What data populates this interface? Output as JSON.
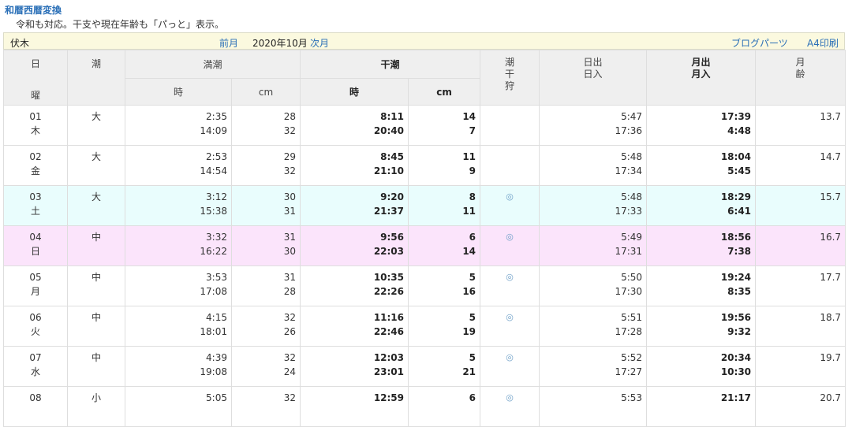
{
  "header": {
    "title_link": "和暦西暦変換",
    "subtitle": "令和も対応。干支や現在年齢も「パっと」表示。"
  },
  "nav": {
    "location": "伏木",
    "prev": "前月",
    "current": "2020年10月",
    "next": "次月",
    "blog_parts": "ブログパーツ",
    "print": "A4印刷"
  },
  "table_head": {
    "day": "日",
    "weekday": "曜",
    "tide": "潮",
    "high_tide": "満潮",
    "low_tide": "干潮",
    "time": "時",
    "cm": "cm",
    "shiohigari": [
      "潮",
      "干",
      "狩"
    ],
    "sunrise": "日出",
    "sunset": "日入",
    "moonrise": "月出",
    "moonset": "月入",
    "moonage": [
      "月",
      "齢"
    ]
  },
  "rows": [
    {
      "day": "01",
      "wd": "木",
      "tide": "大",
      "high": [
        [
          "2:35",
          "28"
        ],
        [
          "14:09",
          "32"
        ]
      ],
      "low": [
        [
          "8:11",
          "14"
        ],
        [
          "20:40",
          "7"
        ]
      ],
      "mark": "",
      "sun": [
        "5:47",
        "17:36"
      ],
      "moon": [
        "17:39",
        "4:48"
      ],
      "age": "13.7"
    },
    {
      "day": "02",
      "wd": "金",
      "tide": "大",
      "high": [
        [
          "2:53",
          "29"
        ],
        [
          "14:54",
          "32"
        ]
      ],
      "low": [
        [
          "8:45",
          "11"
        ],
        [
          "21:10",
          "9"
        ]
      ],
      "mark": "",
      "sun": [
        "5:48",
        "17:34"
      ],
      "moon": [
        "18:04",
        "5:45"
      ],
      "age": "14.7"
    },
    {
      "day": "03",
      "wd": "土",
      "tide": "大",
      "high": [
        [
          "3:12",
          "30"
        ],
        [
          "15:38",
          "31"
        ]
      ],
      "low": [
        [
          "9:20",
          "8"
        ],
        [
          "21:37",
          "11"
        ]
      ],
      "mark": "◎",
      "sun": [
        "5:48",
        "17:33"
      ],
      "moon": [
        "18:29",
        "6:41"
      ],
      "age": "15.7"
    },
    {
      "day": "04",
      "wd": "日",
      "tide": "中",
      "high": [
        [
          "3:32",
          "31"
        ],
        [
          "16:22",
          "30"
        ]
      ],
      "low": [
        [
          "9:56",
          "6"
        ],
        [
          "22:03",
          "14"
        ]
      ],
      "mark": "◎",
      "sun": [
        "5:49",
        "17:31"
      ],
      "moon": [
        "18:56",
        "7:38"
      ],
      "age": "16.7"
    },
    {
      "day": "05",
      "wd": "月",
      "tide": "中",
      "high": [
        [
          "3:53",
          "31"
        ],
        [
          "17:08",
          "28"
        ]
      ],
      "low": [
        [
          "10:35",
          "5"
        ],
        [
          "22:26",
          "16"
        ]
      ],
      "mark": "◎",
      "sun": [
        "5:50",
        "17:30"
      ],
      "moon": [
        "19:24",
        "8:35"
      ],
      "age": "17.7"
    },
    {
      "day": "06",
      "wd": "火",
      "tide": "中",
      "high": [
        [
          "4:15",
          "32"
        ],
        [
          "18:01",
          "26"
        ]
      ],
      "low": [
        [
          "11:16",
          "5"
        ],
        [
          "22:46",
          "19"
        ]
      ],
      "mark": "◎",
      "sun": [
        "5:51",
        "17:28"
      ],
      "moon": [
        "19:56",
        "9:32"
      ],
      "age": "18.7"
    },
    {
      "day": "07",
      "wd": "水",
      "tide": "中",
      "high": [
        [
          "4:39",
          "32"
        ],
        [
          "19:08",
          "24"
        ]
      ],
      "low": [
        [
          "12:03",
          "5"
        ],
        [
          "23:01",
          "21"
        ]
      ],
      "mark": "◎",
      "sun": [
        "5:52",
        "17:27"
      ],
      "moon": [
        "20:34",
        "10:30"
      ],
      "age": "19.7"
    },
    {
      "day": "08",
      "wd": "",
      "tide": "小",
      "high": [
        [
          "5:05",
          "32"
        ],
        [
          "",
          ""
        ]
      ],
      "low": [
        [
          "12:59",
          "6"
        ],
        [
          "",
          ""
        ]
      ],
      "mark": "◎",
      "sun": [
        "5:53",
        ""
      ],
      "moon": [
        "21:17",
        ""
      ],
      "age": "20.7"
    }
  ]
}
